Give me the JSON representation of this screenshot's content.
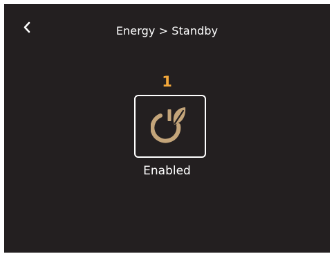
{
  "header": {
    "back_icon": "chevron-left-icon",
    "title": "Energy > Standby"
  },
  "standby": {
    "number": "1",
    "icon": "standby-eco-leaf-icon",
    "status": "Enabled",
    "accent_color": "#f3a83b",
    "icon_color": "#c4a57a"
  },
  "colors": {
    "background": "#231f20",
    "text": "#ffffff"
  }
}
